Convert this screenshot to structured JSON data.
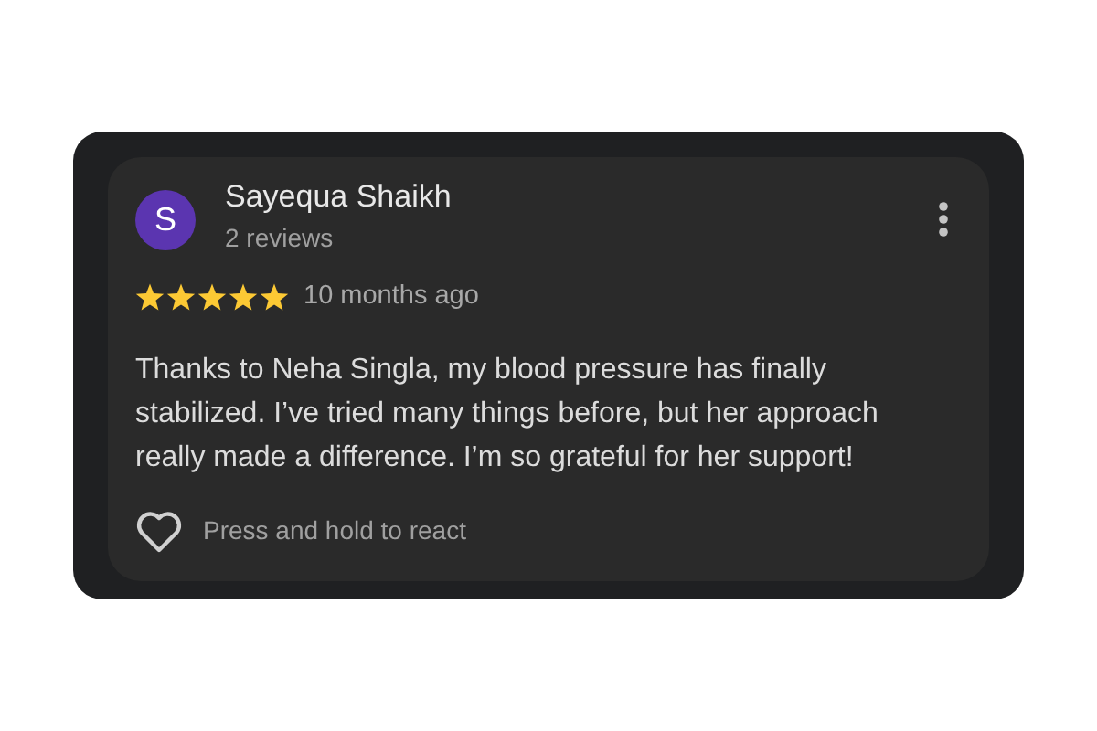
{
  "review": {
    "avatar_letter": "S",
    "author": "Sayequa Shaikh",
    "author_meta": "2 reviews",
    "stars": 5,
    "time": "10 months ago",
    "text": "Thanks to Neha Singla, my blood pressure has finally stabilized. I’ve tried many things before, but her approach really made a difference. I’m so grateful for her support!",
    "reacted": false,
    "react_hint": "Press and hold to react"
  }
}
